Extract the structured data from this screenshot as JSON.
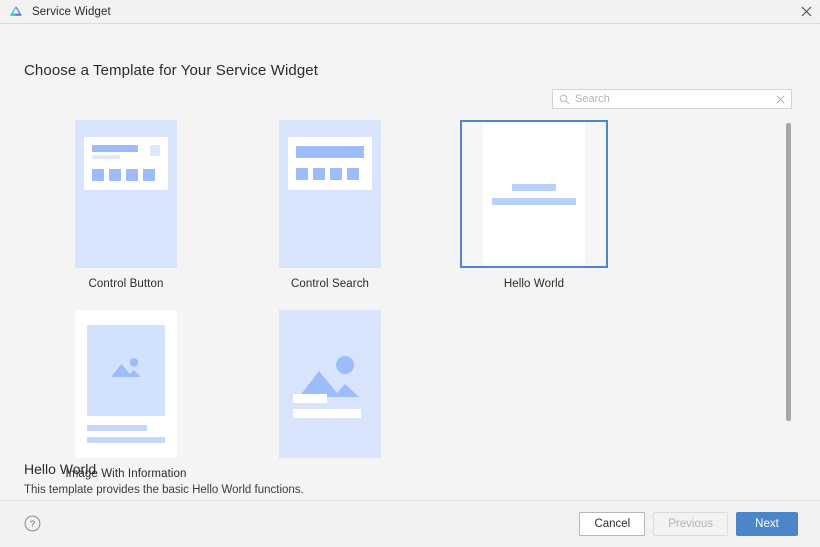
{
  "window": {
    "title": "Service Widget",
    "logo_icon": "deveco-triangle-logo-icon",
    "close_icon": "close-icon"
  },
  "page": {
    "title": "Choose a Template for Your Service Widget"
  },
  "search": {
    "placeholder": "Search",
    "value": "",
    "search_icon": "search-icon",
    "clear_icon": "clear-x-icon"
  },
  "templates": [
    {
      "label": "Control Button",
      "thumb": "control-button-thumb",
      "selected": false
    },
    {
      "label": "Control Search",
      "thumb": "control-search-thumb",
      "selected": false
    },
    {
      "label": "Hello World",
      "thumb": "hello-world-thumb",
      "selected": true
    },
    {
      "label": "Image With Information",
      "thumb": "image-with-information-thumb",
      "selected": false
    },
    {
      "label": "",
      "thumb": "image-large-thumb",
      "selected": false
    }
  ],
  "selection": {
    "name": "Hello World",
    "description": "This template provides the basic Hello World functions."
  },
  "footer": {
    "help_icon": "help-question-icon",
    "cancel_label": "Cancel",
    "previous_label": "Previous",
    "next_label": "Next"
  },
  "colors": {
    "accent": "#4a86c8",
    "selected_border": "#4f85c9",
    "thumb_bg": "#d7e4fc",
    "thumb_blue": "#9dbdfa",
    "window_bg": "#f2f2f2",
    "body_bg": "#f4f4f4"
  },
  "scrollbar": {
    "orientation": "vertical"
  }
}
